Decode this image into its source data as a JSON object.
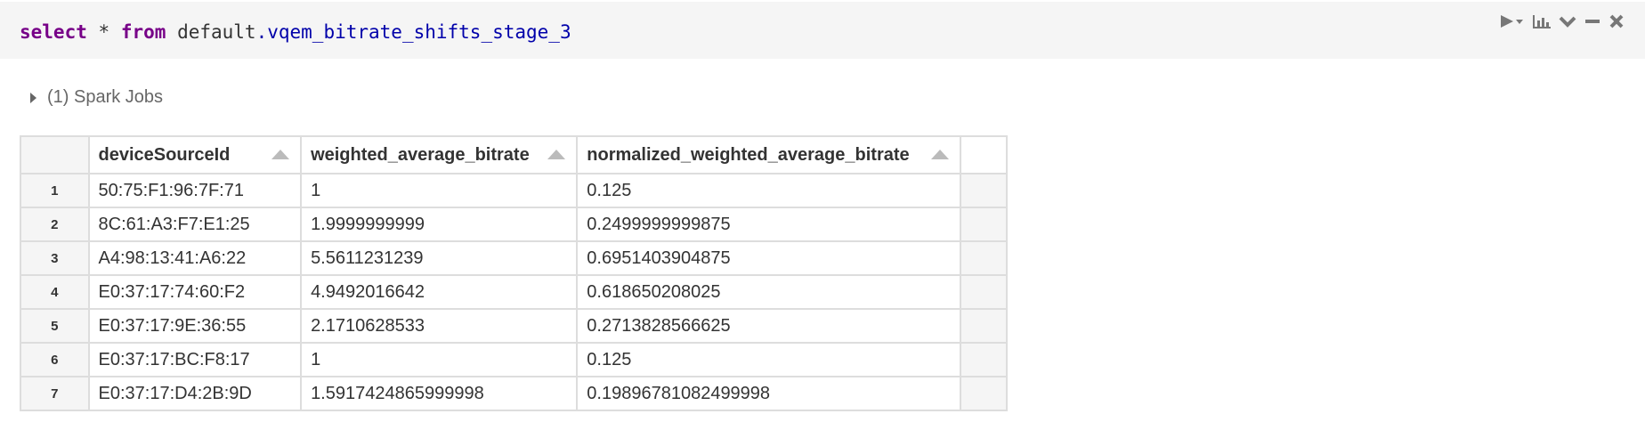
{
  "code": {
    "keyword_select": "select",
    "star": "*",
    "keyword_from": "from",
    "schema": "default",
    "dot": ".",
    "table": "vqem_bitrate_shifts_stage_3"
  },
  "toolbar": {
    "run_icon": "play-icon",
    "chart_icon": "bar-chart-icon",
    "collapse_icon": "chevron-down-icon",
    "minimize_icon": "minus-icon",
    "close_icon": "close-icon"
  },
  "spark_jobs": {
    "label": "(1) Spark Jobs"
  },
  "table": {
    "columns": [
      "deviceSourceId",
      "weighted_average_bitrate",
      "normalized_weighted_average_bitrate"
    ],
    "rows": [
      {
        "num": "1",
        "deviceSourceId": "50:75:F1:96:7F:71",
        "weighted": "1",
        "normalized": "0.125"
      },
      {
        "num": "2",
        "deviceSourceId": "8C:61:A3:F7:E1:25",
        "weighted": "1.9999999999",
        "normalized": "0.2499999999875"
      },
      {
        "num": "3",
        "deviceSourceId": "A4:98:13:41:A6:22",
        "weighted": "5.5611231239",
        "normalized": "0.6951403904875"
      },
      {
        "num": "4",
        "deviceSourceId": "E0:37:17:74:60:F2",
        "weighted": "4.9492016642",
        "normalized": "0.618650208025"
      },
      {
        "num": "5",
        "deviceSourceId": "E0:37:17:9E:36:55",
        "weighted": "2.1710628533",
        "normalized": "0.2713828566625"
      },
      {
        "num": "6",
        "deviceSourceId": "E0:37:17:BC:F8:17",
        "weighted": "1",
        "normalized": "0.125"
      },
      {
        "num": "7",
        "deviceSourceId": "E0:37:17:D4:2B:9D",
        "weighted": "1.5917424865999998",
        "normalized": "0.19896781082499998"
      }
    ]
  },
  "colors": {
    "keyword": "#770088",
    "table_name": "#0000aa",
    "code_bg": "#f5f5f5",
    "border": "#dddddd"
  }
}
